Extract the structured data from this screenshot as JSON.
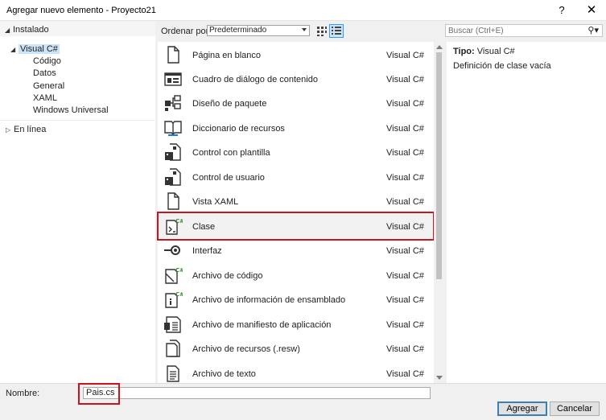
{
  "window": {
    "title": "Agregar nuevo elemento - Proyecto21",
    "help": "?",
    "close": "✕"
  },
  "tree": {
    "installed": "Instalado",
    "visual_csharp": "Visual C#",
    "children": [
      "Código",
      "Datos",
      "General",
      "XAML",
      "Windows Universal"
    ],
    "online": "En línea"
  },
  "toolbar": {
    "sort_label": "Ordenar por:",
    "sort_value": "Predeterminado",
    "search_placeholder": "Buscar (Ctrl+E)"
  },
  "items": [
    {
      "name": "Página en blanco",
      "lang": "Visual C#",
      "icon": "blank-page-icon"
    },
    {
      "name": "Cuadro de diálogo de contenido",
      "lang": "Visual C#",
      "icon": "content-dialog-icon"
    },
    {
      "name": "Diseño de paquete",
      "lang": "Visual C#",
      "icon": "package-design-icon"
    },
    {
      "name": "Diccionario de recursos",
      "lang": "Visual C#",
      "icon": "resource-dictionary-icon"
    },
    {
      "name": "Control con plantilla",
      "lang": "Visual C#",
      "icon": "templated-control-icon"
    },
    {
      "name": "Control de usuario",
      "lang": "Visual C#",
      "icon": "user-control-icon"
    },
    {
      "name": "Vista XAML",
      "lang": "Visual C#",
      "icon": "xaml-view-icon"
    },
    {
      "name": "Clase",
      "lang": "Visual C#",
      "icon": "class-icon"
    },
    {
      "name": "Interfaz",
      "lang": "Visual C#",
      "icon": "interface-icon"
    },
    {
      "name": "Archivo de código",
      "lang": "Visual C#",
      "icon": "code-file-icon"
    },
    {
      "name": "Archivo de información de ensamblado",
      "lang": "Visual C#",
      "icon": "assembly-info-icon"
    },
    {
      "name": "Archivo de manifiesto de aplicación",
      "lang": "Visual C#",
      "icon": "app-manifest-icon"
    },
    {
      "name": "Archivo de recursos (.resw)",
      "lang": "Visual C#",
      "icon": "resw-file-icon"
    },
    {
      "name": "Archivo de texto",
      "lang": "Visual C#",
      "icon": "text-file-icon"
    }
  ],
  "details": {
    "type_label": "Tipo:",
    "type_value": "Visual C#",
    "description": "Definición de clase vacía"
  },
  "bottom": {
    "name_label": "Nombre:",
    "name_value": "Pais.cs",
    "add_label": "Agregar",
    "cancel_label": "Cancelar"
  },
  "colors": {
    "accent": "#3399ff",
    "highlight": "#d0101b",
    "csharp_green": "#388a34"
  }
}
